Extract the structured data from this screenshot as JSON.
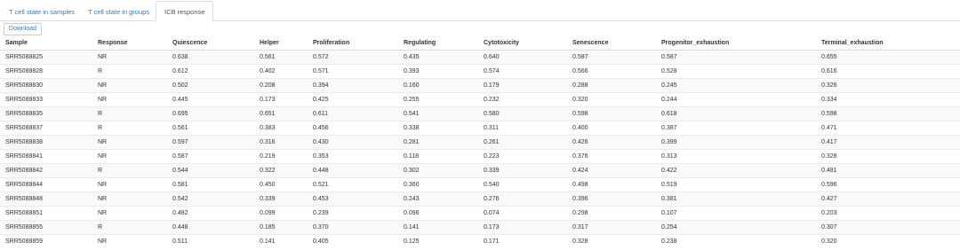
{
  "tabs": [
    {
      "label": "T cell state in samples",
      "active": false
    },
    {
      "label": "T cell state in groups",
      "active": false
    },
    {
      "label": "ICB response",
      "active": true
    }
  ],
  "toolbar": {
    "download_label": "Download"
  },
  "table": {
    "columns": [
      "Sample",
      "Response",
      "Quiescence",
      "Helper",
      "Proliferation",
      "Regulating",
      "Cytotoxicity",
      "Senescence",
      "Progenitor_exhaustion",
      "Terminal_exhaustion"
    ],
    "rows": [
      [
        "SRR5088825",
        "NR",
        "0.638",
        "0.561",
        "0.572",
        "0.435",
        "0.640",
        "0.587",
        "0.587",
        "0.655"
      ],
      [
        "SRR5088828",
        "R",
        "0.612",
        "0.402",
        "0.571",
        "0.393",
        "0.574",
        "0.566",
        "0.528",
        "0.616"
      ],
      [
        "SRR5088830",
        "NR",
        "0.502",
        "0.208",
        "0.394",
        "0.160",
        "0.179",
        "0.288",
        "0.245",
        "0.326"
      ],
      [
        "SRR5088833",
        "NR",
        "0.445",
        "0.173",
        "0.425",
        "0.255",
        "0.232",
        "0.320",
        "0.244",
        "0.334"
      ],
      [
        "SRR5088835",
        "R",
        "0.695",
        "0.651",
        "0.611",
        "0.541",
        "0.580",
        "0.598",
        "0.618",
        "0.598"
      ],
      [
        "SRR5088837",
        "R",
        "0.561",
        "0.383",
        "0.456",
        "0.338",
        "0.311",
        "0.400",
        "0.387",
        "0.471"
      ],
      [
        "SRR5088838",
        "NR",
        "0.597",
        "0.316",
        "0.430",
        "0.281",
        "0.261",
        "0.426",
        "0.399",
        "0.417"
      ],
      [
        "SRR5088841",
        "NR",
        "0.587",
        "0.219",
        "0.353",
        "0.118",
        "0.223",
        "0.376",
        "0.313",
        "0.328"
      ],
      [
        "SRR5088842",
        "R",
        "0.544",
        "0.322",
        "0.448",
        "0.302",
        "0.339",
        "0.424",
        "0.422",
        "0.481"
      ],
      [
        "SRR5088844",
        "NR",
        "0.581",
        "0.450",
        "0.521",
        "0.360",
        "0.540",
        "0.498",
        "0.519",
        "0.596"
      ],
      [
        "SRR5088848",
        "NR",
        "0.542",
        "0.339",
        "0.453",
        "0.243",
        "0.276",
        "0.396",
        "0.381",
        "0.427"
      ],
      [
        "SRR5088851",
        "NR",
        "0.482",
        "0.099",
        "0.239",
        "0.096",
        "0.074",
        "0.298",
        "0.107",
        "0.203"
      ],
      [
        "SRR5088855",
        "R",
        "0.448",
        "0.185",
        "0.370",
        "0.141",
        "0.173",
        "0.317",
        "0.254",
        "0.307"
      ],
      [
        "SRR5088859",
        "NR",
        "0.511",
        "0.141",
        "0.405",
        "0.125",
        "0.171",
        "0.328",
        "0.238",
        "0.320"
      ]
    ]
  },
  "colors": {
    "link": "#337ab7",
    "border": "#dddddd",
    "stripe": "#f9f9f9",
    "text": "#333333"
  }
}
